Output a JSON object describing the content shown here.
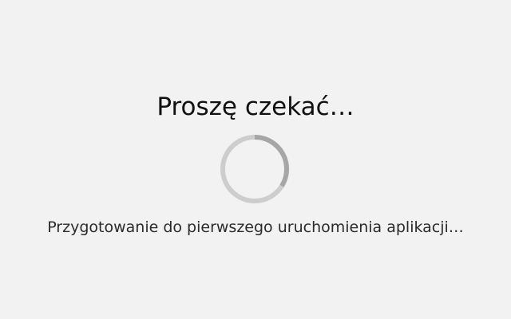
{
  "loading": {
    "title": "Proszę czekać…",
    "message": "Przygotowanie do pierwszego uruchomienia aplikacji…",
    "spinner_icon": "loading-spinner-icon",
    "colors": {
      "background": "#f2f2f2",
      "spinner_track": "#cdcdcd",
      "spinner_arc": "#a6a6a6"
    }
  }
}
